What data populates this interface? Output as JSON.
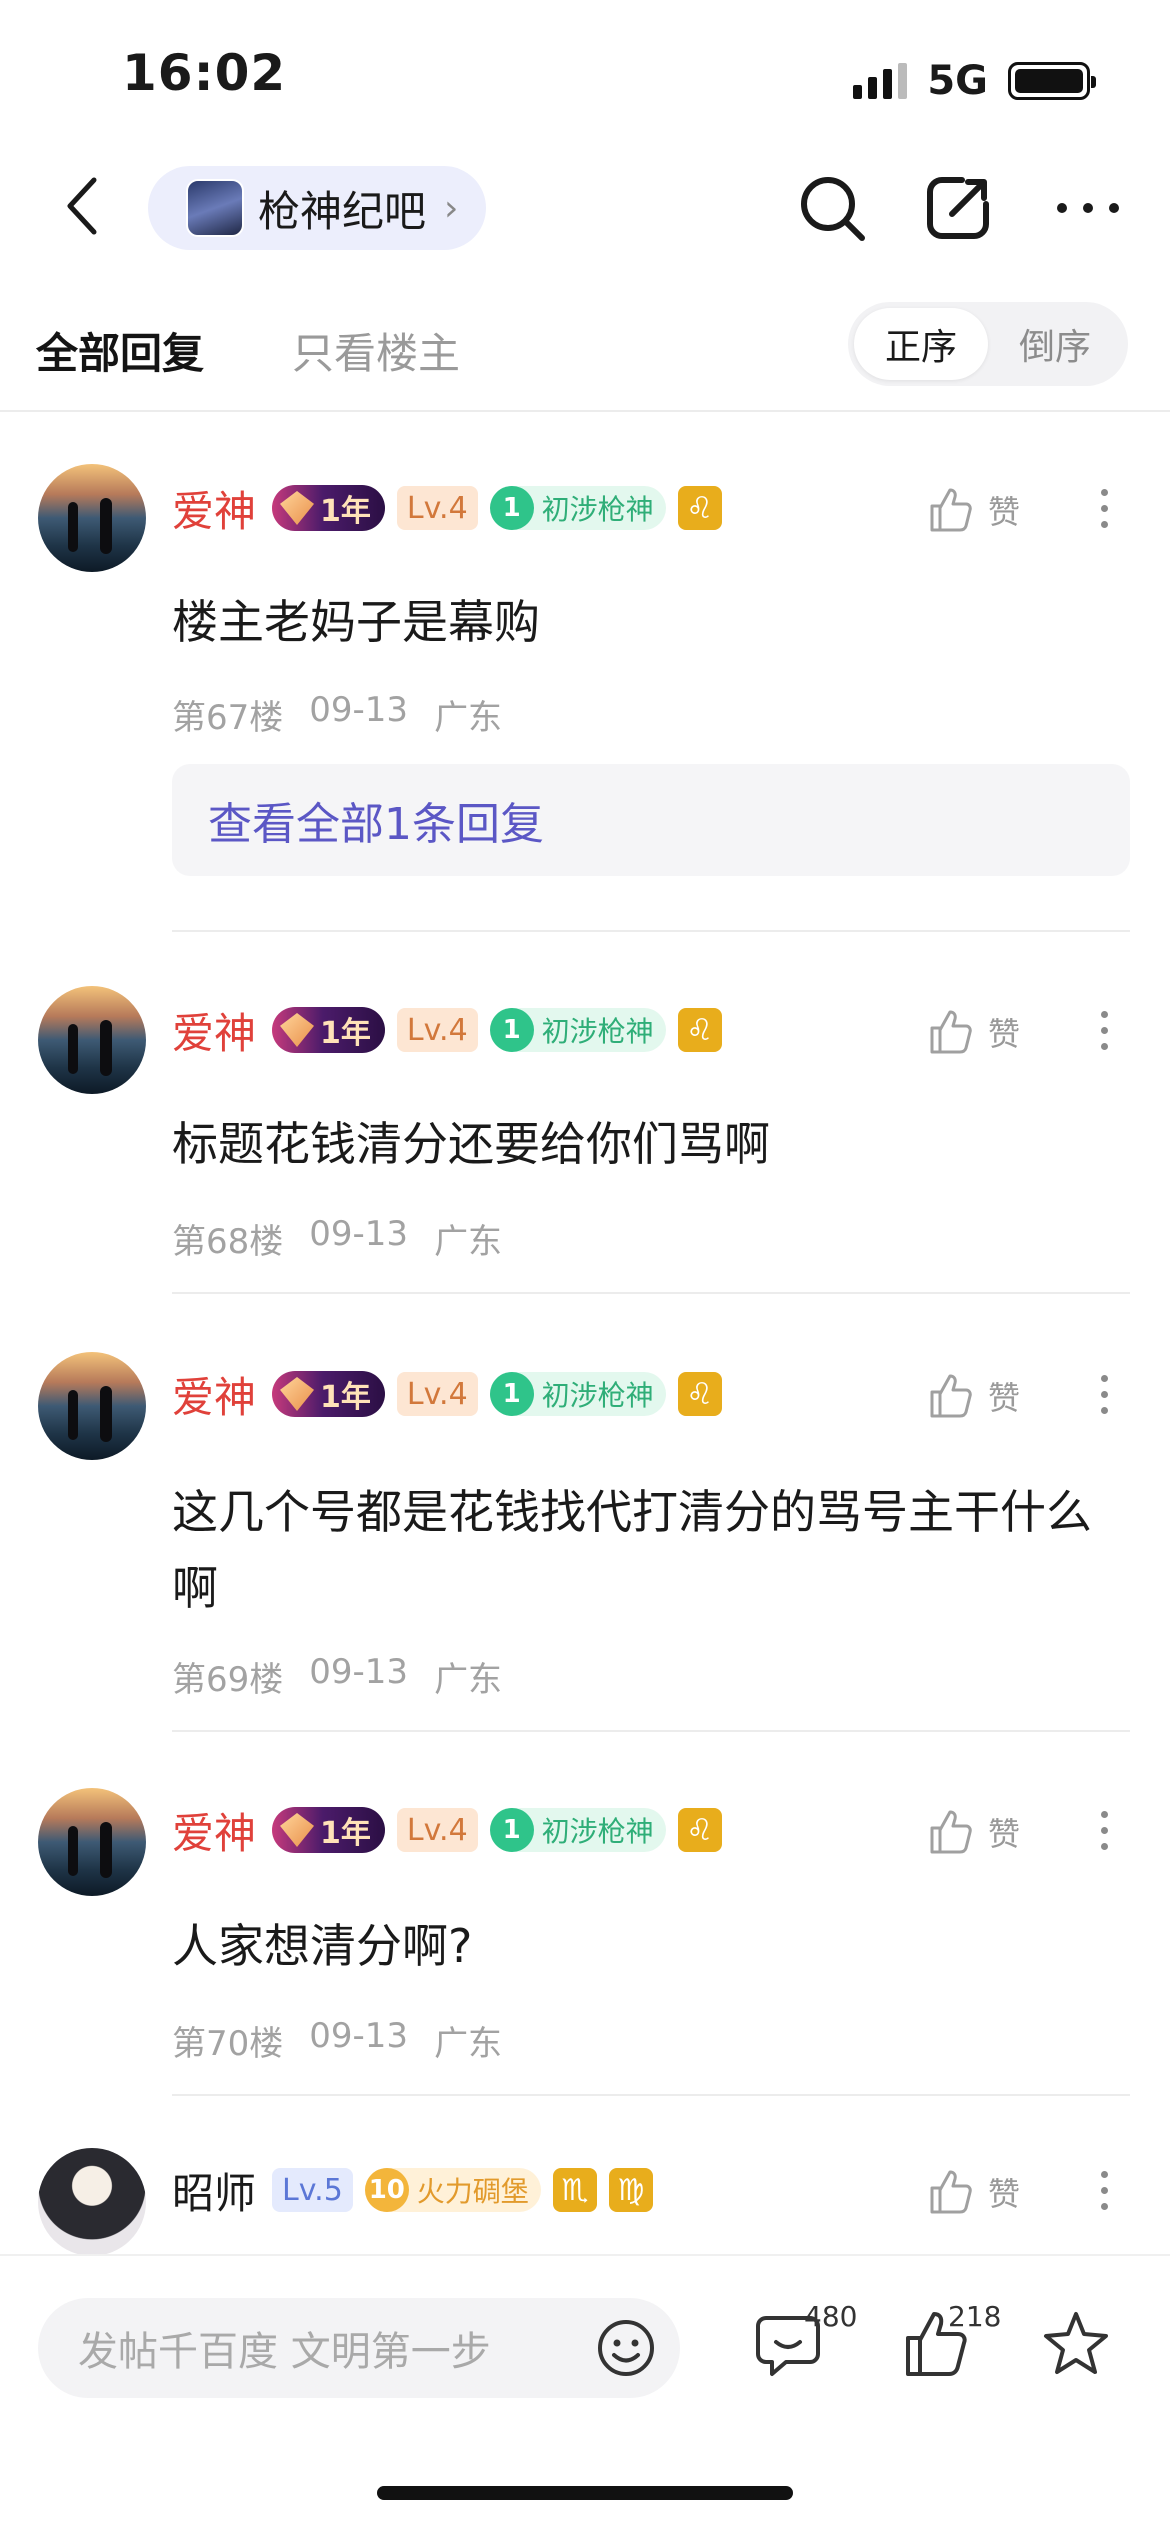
{
  "status_bar": {
    "time": "16:02",
    "network": "5G"
  },
  "header": {
    "forum_name": "枪神纪吧"
  },
  "tabs": {
    "all_replies": "全部回复",
    "only_op": "只看楼主"
  },
  "order": {
    "asc": "正序",
    "desc": "倒序"
  },
  "posts": [
    {
      "username": "爱神",
      "year_badge": "1年",
      "level": "Lv.4",
      "rank_num": "1",
      "rank_title": "初涉枪神",
      "zodiac": [
        "♌"
      ],
      "like_label": "赞",
      "content": "楼主老妈子是幕购",
      "floor": "第67楼",
      "date": "09-13",
      "location": "广东",
      "reply_link": "查看全部1条回复"
    },
    {
      "username": "爱神",
      "year_badge": "1年",
      "level": "Lv.4",
      "rank_num": "1",
      "rank_title": "初涉枪神",
      "zodiac": [
        "♌"
      ],
      "like_label": "赞",
      "content": "标题花钱清分还要给你们骂啊",
      "floor": "第68楼",
      "date": "09-13",
      "location": "广东"
    },
    {
      "username": "爱神",
      "year_badge": "1年",
      "level": "Lv.4",
      "rank_num": "1",
      "rank_title": "初涉枪神",
      "zodiac": [
        "♌"
      ],
      "like_label": "赞",
      "content": "这几个号都是花钱找代打清分的骂号主干什么啊",
      "floor": "第69楼",
      "date": "09-13",
      "location": "广东"
    },
    {
      "username": "爱神",
      "year_badge": "1年",
      "level": "Lv.4",
      "rank_num": "1",
      "rank_title": "初涉枪神",
      "zodiac": [
        "♌"
      ],
      "like_label": "赞",
      "content": "人家想清分啊?",
      "floor": "第70楼",
      "date": "09-13",
      "location": "广东"
    },
    {
      "username": "昭师",
      "level": "Lv.5",
      "rank_num": "10",
      "rank_title": "火力碉堡",
      "zodiac": [
        "♏",
        "♍"
      ],
      "like_label": "赞"
    }
  ],
  "bottom_bar": {
    "compose_placeholder": "发帖千百度 文明第一步",
    "comment_count": "480",
    "like_count": "218"
  },
  "colors": {
    "accent_purple": "#5b57c5",
    "username_red": "#e0413a",
    "rank_green": "#2fae78"
  }
}
